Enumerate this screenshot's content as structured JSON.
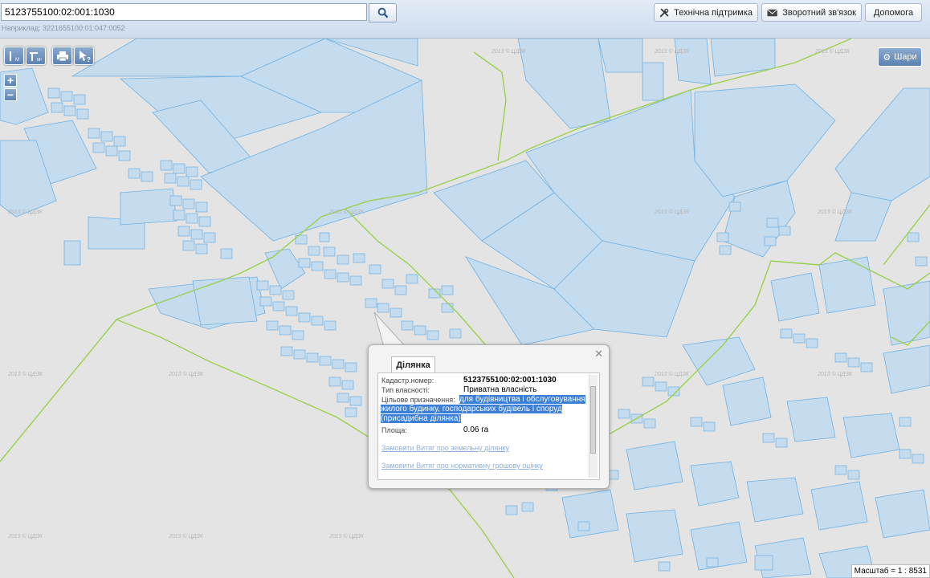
{
  "search": {
    "value": "5123755100:02:001:1030",
    "hint": "Наприклад: 3221655100:01:047:0052"
  },
  "header": {
    "buttons": [
      {
        "label": "Технічна підтримка",
        "icon": "tools-icon"
      },
      {
        "label": "Зворотний зв'язок",
        "icon": "mail-icon"
      },
      {
        "label": "Допомога"
      }
    ]
  },
  "map": {
    "layers_label": "Шари",
    "scale_label": "Масштаб = 1 : 8531",
    "watermark": "2013 © ЦДЗК",
    "colors": {
      "parcel_fill": "#c5dbee",
      "parcel_stroke": "#6fb2e4",
      "boundary": "#9ad14c",
      "background": "#e4e4e4"
    }
  },
  "popup": {
    "tab": "Ділянка",
    "fields": [
      {
        "label": "Кадастр.номер:",
        "value": "5123755100:02:001:1030"
      },
      {
        "label": "Тип власності:",
        "value": "Приватна власність"
      },
      {
        "label": "Цільове призначення:",
        "value": "для будівництва і обслуговування жилого будинку, господарських будівель і споруд (присадибна ділянка)"
      },
      {
        "label": "Площа:",
        "value": "0.06 га"
      }
    ],
    "links": [
      "Замовити Витяг про земельну ділянку",
      "Замовити Витяг про нормативну грошову оцінку"
    ]
  }
}
